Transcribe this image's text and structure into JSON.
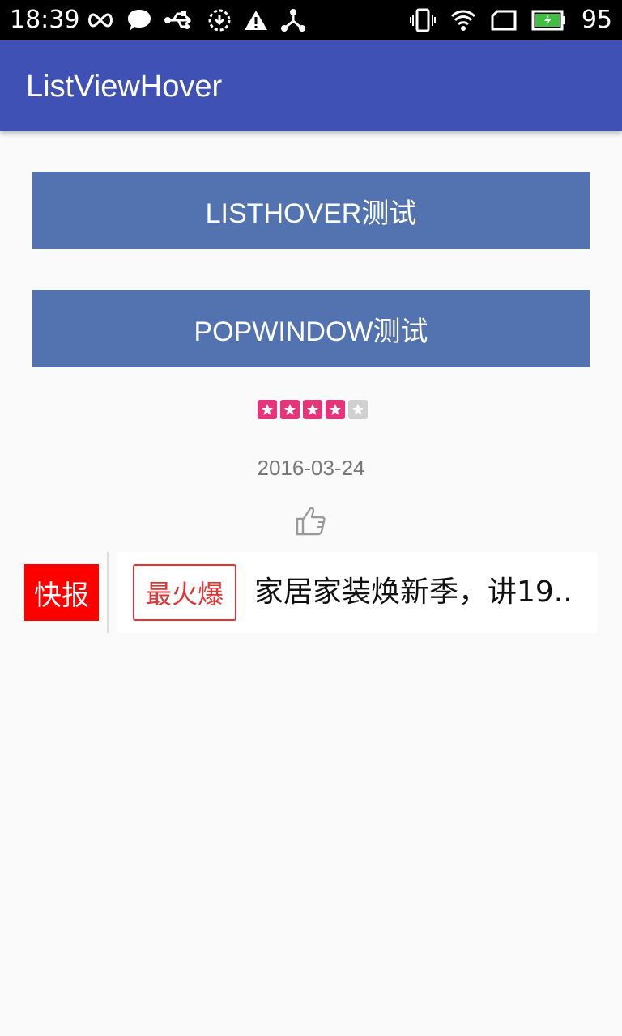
{
  "status_bar": {
    "time": "18:39",
    "battery_level": "95",
    "icons_left": [
      "infinity-icon",
      "chat-bubble-icon",
      "usb-icon",
      "download-icon",
      "warning-icon",
      "share-node-icon"
    ],
    "icons_right": [
      "vibrate-icon",
      "wifi-icon",
      "sim-icon",
      "battery-icon"
    ]
  },
  "app_bar": {
    "title": "ListViewHover",
    "color": "#3f51b5"
  },
  "buttons": {
    "listhover_label": "LISTHOVER测试",
    "popwindow_label": "POPWINDOW测试",
    "color": "#5373b0"
  },
  "rating": {
    "value": 4,
    "max": 5,
    "on_color": "#e6347a"
  },
  "date": "2016-03-24",
  "like_icon": "thumbs-up-icon",
  "news": {
    "badge": "快报",
    "tag": "最火爆",
    "headline": "家居家装焕新季，讲19..",
    "badge_color": "#ff0000"
  }
}
